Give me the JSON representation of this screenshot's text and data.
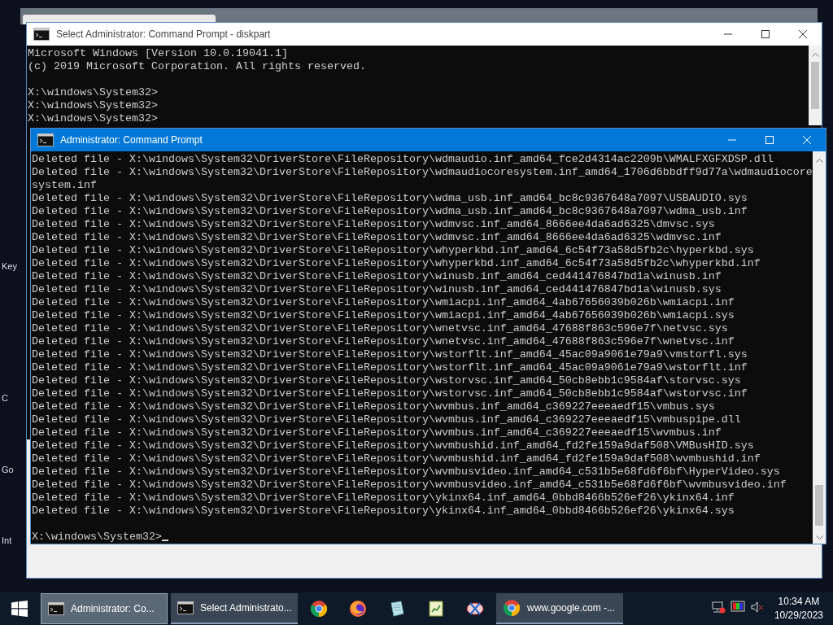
{
  "desktop": {
    "icon_labels": [
      "Key",
      "C",
      "Go",
      "Int"
    ]
  },
  "windows": [
    {
      "title": "Select Administrator: Command Prompt - diskpart",
      "active": false,
      "blocks": [
        [
          "Microsoft Windows [Version 10.0.19041.1]",
          "(c) 2019 Microsoft Corporation. All rights reserved."
        ],
        [
          "X:\\windows\\System32>",
          "X:\\windows\\System32>",
          "X:\\windows\\System32>"
        ]
      ]
    },
    {
      "title": "Administrator: Command Prompt",
      "active": true,
      "blocks": [
        [
          "Deleted file - X:\\windows\\System32\\DriverStore\\FileRepository\\wdmaudio.inf_amd64_fce2d4314ac2209b\\WMALFXGFXDSP.dll",
          "Deleted file - X:\\windows\\System32\\DriverStore\\FileRepository\\wdmaudiocoresystem.inf_amd64_1706d6bbdff9d77a\\wdmaudiocore",
          "system.inf",
          "Deleted file - X:\\windows\\System32\\DriverStore\\FileRepository\\wdma_usb.inf_amd64_bc8c9367648a7097\\USBAUDIO.sys",
          "Deleted file - X:\\windows\\System32\\DriverStore\\FileRepository\\wdma_usb.inf_amd64_bc8c9367648a7097\\wdma_usb.inf",
          "Deleted file - X:\\windows\\System32\\DriverStore\\FileRepository\\wdmvsc.inf_amd64_8666ee4da6ad6325\\dmvsc.sys",
          "Deleted file - X:\\windows\\System32\\DriverStore\\FileRepository\\wdmvsc.inf_amd64_8666ee4da6ad6325\\wdmvsc.inf",
          "Deleted file - X:\\windows\\System32\\DriverStore\\FileRepository\\whyperkbd.inf_amd64_6c54f73a58d5fb2c\\hyperkbd.sys",
          "Deleted file - X:\\windows\\System32\\DriverStore\\FileRepository\\whyperkbd.inf_amd64_6c54f73a58d5fb2c\\whyperkbd.inf",
          "Deleted file - X:\\windows\\System32\\DriverStore\\FileRepository\\winusb.inf_amd64_ced441476847bd1a\\winusb.inf",
          "Deleted file - X:\\windows\\System32\\DriverStore\\FileRepository\\winusb.inf_amd64_ced441476847bd1a\\winusb.sys",
          "Deleted file - X:\\windows\\System32\\DriverStore\\FileRepository\\wmiacpi.inf_amd64_4ab67656039b026b\\wmiacpi.inf",
          "Deleted file - X:\\windows\\System32\\DriverStore\\FileRepository\\wmiacpi.inf_amd64_4ab67656039b026b\\wmiacpi.sys",
          "Deleted file - X:\\windows\\System32\\DriverStore\\FileRepository\\wnetvsc.inf_amd64_47688f863c596e7f\\netvsc.sys",
          "Deleted file - X:\\windows\\System32\\DriverStore\\FileRepository\\wnetvsc.inf_amd64_47688f863c596e7f\\wnetvsc.inf",
          "Deleted file - X:\\windows\\System32\\DriverStore\\FileRepository\\wstorflt.inf_amd64_45ac09a9061e79a9\\vmstorfl.sys",
          "Deleted file - X:\\windows\\System32\\DriverStore\\FileRepository\\wstorflt.inf_amd64_45ac09a9061e79a9\\wstorflt.inf",
          "Deleted file - X:\\windows\\System32\\DriverStore\\FileRepository\\wstorvsc.inf_amd64_50cb8ebb1c9584af\\storvsc.sys",
          "Deleted file - X:\\windows\\System32\\DriverStore\\FileRepository\\wstorvsc.inf_amd64_50cb8ebb1c9584af\\wstorvsc.inf",
          "Deleted file - X:\\windows\\System32\\DriverStore\\FileRepository\\wvmbus.inf_amd64_c369227eeeaedf15\\vmbus.sys",
          "Deleted file - X:\\windows\\System32\\DriverStore\\FileRepository\\wvmbus.inf_amd64_c369227eeeaedf15\\vmbuspipe.dll",
          "Deleted file - X:\\windows\\System32\\DriverStore\\FileRepository\\wvmbus.inf_amd64_c369227eeeaedf15\\wvmbus.inf",
          "Deleted file - X:\\windows\\System32\\DriverStore\\FileRepository\\wvmbushid.inf_amd64_fd2fe159a9daf508\\VMBusHID.sys",
          "Deleted file - X:\\windows\\System32\\DriverStore\\FileRepository\\wvmbushid.inf_amd64_fd2fe159a9daf508\\wvmbushid.inf",
          "Deleted file - X:\\windows\\System32\\DriverStore\\FileRepository\\wvmbusvideo.inf_amd64_c531b5e68fd6f6bf\\HyperVideo.sys",
          "Deleted file - X:\\windows\\System32\\DriverStore\\FileRepository\\wvmbusvideo.inf_amd64_c531b5e68fd6f6bf\\wvmbusvideo.inf",
          "Deleted file - X:\\windows\\System32\\DriverStore\\FileRepository\\ykinx64.inf_amd64_0bbd8466b526ef26\\ykinx64.inf",
          "Deleted file - X:\\windows\\System32\\DriverStore\\FileRepository\\ykinx64.inf_amd64_0bbd8466b526ef26\\ykinx64.sys"
        ],
        [
          "X:\\windows\\System32>"
        ]
      ]
    }
  ],
  "taskbar": {
    "items": [
      {
        "kind": "window",
        "label": "Administrator: Co...",
        "selected": true
      },
      {
        "kind": "window",
        "label": "Select Administrato...",
        "selected": false
      },
      {
        "kind": "pinned"
      },
      {
        "kind": "pinned"
      },
      {
        "kind": "pinned"
      },
      {
        "kind": "pinned"
      },
      {
        "kind": "pinned"
      },
      {
        "kind": "window",
        "label": "www.google.com -...",
        "selected": false
      }
    ],
    "time": "10:34 AM",
    "date": "10/29/2023"
  }
}
